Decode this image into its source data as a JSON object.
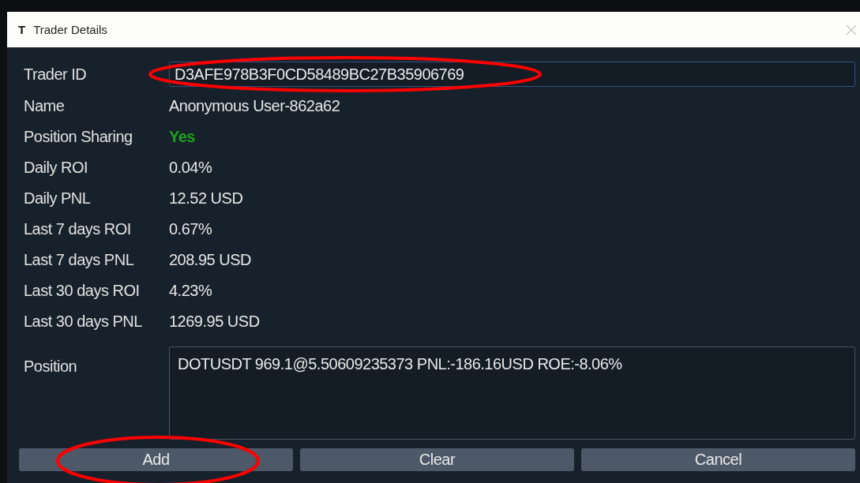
{
  "window": {
    "title": "Trader Details",
    "icon": "T"
  },
  "trader_id": {
    "label": "Trader ID",
    "value": "D3AFE978B3F0CD58489BC27B35906769",
    "circled": true
  },
  "rows": [
    {
      "label": "Name",
      "value": "Anonymous User-862a62",
      "kind": "text"
    },
    {
      "label": "Position Sharing",
      "value": "Yes",
      "kind": "status"
    },
    {
      "label": "Daily ROI",
      "value": "0.04%",
      "kind": "text"
    },
    {
      "label": "Daily PNL",
      "value": "12.52 USD",
      "kind": "text"
    },
    {
      "label": "Last 7 days ROI",
      "value": "0.67%",
      "kind": "text"
    },
    {
      "label": "Last 7 days PNL",
      "value": "208.95 USD",
      "kind": "text"
    },
    {
      "label": "Last 30 days ROI",
      "value": "4.23%",
      "kind": "text"
    },
    {
      "label": "Last 30 days PNL",
      "value": "1269.95 USD",
      "kind": "text"
    }
  ],
  "position": {
    "label": "Position",
    "value": "DOTUSDT 969.1@5.50609235373 PNL:-186.16USD ROE:-8.06%"
  },
  "buttons": [
    {
      "label": "Add",
      "circled": true
    },
    {
      "label": "Clear",
      "circled": false
    },
    {
      "label": "Cancel",
      "circled": false
    }
  ]
}
